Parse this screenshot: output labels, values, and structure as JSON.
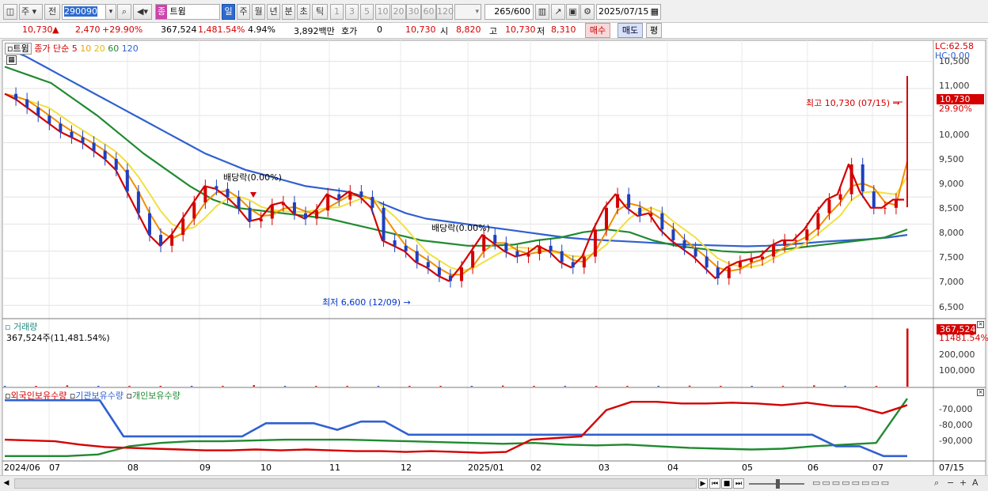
{
  "toolbar": {
    "market": "주",
    "prev": "전",
    "code": "290090",
    "name": "트윔",
    "type_badge": "종",
    "periods": [
      "일",
      "주",
      "월",
      "년",
      "분",
      "초",
      "틱"
    ],
    "period_selected": "일",
    "intervals": [
      "1",
      "3",
      "5",
      "10",
      "20",
      "30",
      "60",
      "120"
    ],
    "count": "265",
    "count_max": "/600",
    "date": "2025/07/15"
  },
  "quote": {
    "price": "10,730",
    "arrow": "▲",
    "change": "2,470",
    "change_pct": "+29.90%",
    "volume": "367,524",
    "volume_pct": "1,481.54%",
    "turnover_pct": "4.94%",
    "amount": "3,892백만",
    "hoga_label": "호가",
    "hoga_value": "0",
    "ask": "10,730",
    "open_label": "시",
    "open": "8,820",
    "high_label": "고",
    "high": "10,730",
    "low_label": "저",
    "low": "8,310",
    "buy": "매수",
    "sell": "매도",
    "eval": "평"
  },
  "price_panel": {
    "name_tag": "트윔",
    "legend_label": "종가 단순",
    "ma": [
      {
        "label": "5",
        "color": "#d40000"
      },
      {
        "label": "10",
        "color": "#f0a000"
      },
      {
        "label": "20",
        "color": "#e8d000"
      },
      {
        "label": "60",
        "color": "#208a30"
      },
      {
        "label": "120",
        "color": "#3060d0"
      }
    ],
    "y_ticks": [
      "11,000",
      "10,500",
      "10,000",
      "9,500",
      "9,000",
      "8,500",
      "8,000",
      "7,500",
      "7,000",
      "6,500"
    ],
    "lc": "LC:62.58",
    "hc": "HC:0.00",
    "last_price": "10,730",
    "last_pct": "29.90%",
    "high_note": "최고 10,730 (07/15)",
    "low_note": "최저 6,600 (12/09)",
    "div1": "배당락(0.00%)",
    "div2": "배당락(0.00%)"
  },
  "volume_panel": {
    "title": "거래량",
    "value": "367,524주(11,481.54%)",
    "y_ticks": [
      "200,000",
      "100,000"
    ],
    "last": "367,524",
    "last_pct": "11481.54%"
  },
  "holding_panel": {
    "legend": [
      {
        "label": "외국인보유수량",
        "color": "#d40000"
      },
      {
        "label": "기관보유수량",
        "color": "#3060d0"
      },
      {
        "label": "개인보유수량",
        "color": "#208a30"
      }
    ],
    "y_ticks": [
      "-70,000",
      "-80,000",
      "-90,000"
    ]
  },
  "x_axis": {
    "labels": [
      "2024/06",
      "07",
      "08",
      "09",
      "10",
      "11",
      "12",
      "2025/01",
      "02",
      "03",
      "04",
      "05",
      "06",
      "07"
    ],
    "right_label": "07/15"
  },
  "chart_data": {
    "type": "line",
    "x_range": [
      "2024/06",
      "2025/07/15"
    ],
    "price_ylim": [
      6300,
      11300
    ],
    "close": [
      10400,
      10300,
      10150,
      10000,
      9850,
      9700,
      9600,
      9500,
      9350,
      9200,
      9000,
      8600,
      8200,
      7800,
      7600,
      7800,
      8100,
      8400,
      8700,
      8650,
      8500,
      8300,
      8050,
      8100,
      8350,
      8400,
      8200,
      8100,
      8250,
      8550,
      8450,
      8600,
      8500,
      8300,
      7700,
      7600,
      7500,
      7300,
      7200,
      7050,
      6950,
      7200,
      7500,
      7800,
      7650,
      7500,
      7400,
      7450,
      7600,
      7500,
      7300,
      7200,
      7400,
      7900,
      8300,
      8550,
      8300,
      8150,
      8200,
      7900,
      7700,
      7550,
      7400,
      7200,
      7000,
      7200,
      7300,
      7350,
      7400,
      7600,
      7700,
      7700,
      7900,
      8200,
      8450,
      8550,
      9100,
      8600,
      8300,
      8300,
      8450,
      10730
    ],
    "ma120": [
      11250,
      11100,
      10900,
      10700,
      10500,
      10300,
      10100,
      9900,
      9700,
      9500,
      9300,
      9150,
      9000,
      8900,
      8800,
      8700,
      8650,
      8600,
      8500,
      8350,
      8200,
      8100,
      8050,
      8000,
      7950,
      7900,
      7850,
      7800,
      7750,
      7720,
      7700,
      7680,
      7660,
      7640,
      7620,
      7610,
      7600,
      7590,
      7600,
      7620,
      7650,
      7680,
      7700,
      7720,
      7750,
      7800
    ],
    "ma60": [
      10900,
      10750,
      10600,
      10300,
      10000,
      9650,
      9300,
      9000,
      8700,
      8450,
      8300,
      8250,
      8200,
      8150,
      8100,
      8000,
      7900,
      7800,
      7700,
      7650,
      7600,
      7600,
      7620,
      7700,
      7750,
      7850,
      7900,
      7850,
      7700,
      7600,
      7550,
      7500,
      7480,
      7500,
      7550,
      7600,
      7650,
      7700,
      7750,
      7900
    ],
    "volume": [
      2000,
      1500,
      8000,
      1200,
      1500,
      1800,
      2500,
      3000,
      9000,
      2000,
      1500,
      1000,
      3500,
      2000,
      2800,
      1500,
      6500,
      1200,
      2000,
      4000,
      1800,
      3000,
      6000,
      1500,
      2500,
      3500,
      8000,
      2000,
      1500,
      367524
    ],
    "foreign_holding": [
      -88000,
      -88500,
      -89000,
      -91000,
      -92500,
      -93000,
      -93500,
      -94000,
      -94500,
      -94500,
      -94000,
      -94500,
      -94000,
      -94500,
      -95000,
      -95000,
      -95500,
      -95000,
      -95500,
      -96000,
      -95500,
      -88000,
      -87000,
      -86000,
      -70000,
      -65000,
      -65000,
      -66000,
      -66000,
      -65500,
      -66000,
      -67000,
      -65500,
      -67500,
      -68000,
      -72000,
      -67000
    ],
    "institution_holding": [
      -64000,
      -64000,
      -64000,
      -64000,
      -64000,
      -86000,
      -86000,
      -86000,
      -86000,
      -86000,
      -86000,
      -78000,
      -78000,
      -78000,
      -82000,
      -77000,
      -77000,
      -85000,
      -85000,
      -85000,
      -85000,
      -85000,
      -85000,
      -85000,
      -85000,
      -85000,
      -85000,
      -85000,
      -85000,
      -85000,
      -85000,
      -85000,
      -85000,
      -85000,
      -85000,
      -92000,
      -92000,
      -98000,
      -98000
    ],
    "individual_holding": [
      -98000,
      -98000,
      -98000,
      -97000,
      -92000,
      -90000,
      -89000,
      -89000,
      -88500,
      -88000,
      -88000,
      -88000,
      -88500,
      -89000,
      -89500,
      -90000,
      -90500,
      -90000,
      -91000,
      -91500,
      -91000,
      -92000,
      -93000,
      -93500,
      -94000,
      -93500,
      -92000,
      -91000,
      -90000,
      -63000
    ]
  }
}
